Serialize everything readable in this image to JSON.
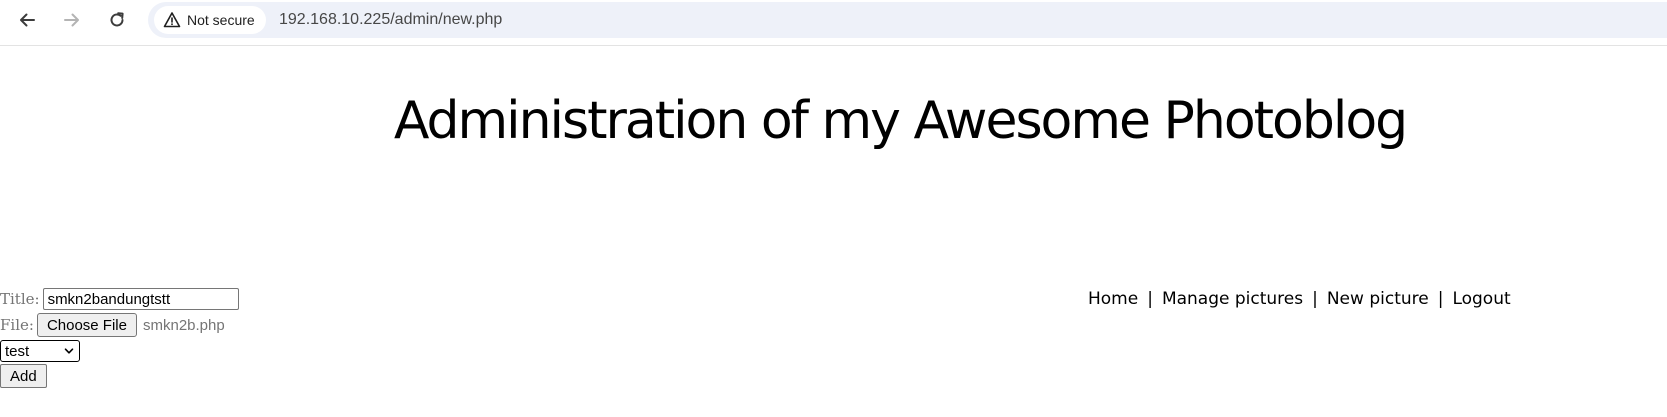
{
  "browser": {
    "security_label": "Not secure",
    "url": "192.168.10.225/admin/new.php"
  },
  "page": {
    "title": "Administration of my Awesome Photoblog",
    "menu": {
      "home": "Home",
      "manage": "Manage pictures",
      "new": "New picture",
      "logout": "Logout",
      "separator": "|"
    },
    "form": {
      "title_label": "Title:",
      "title_value": "smkn2bandungtstt",
      "file_label": "File:",
      "choose_file_label": "Choose File",
      "file_name": "smkn2b.php",
      "select_value": "test",
      "add_label": "Add"
    }
  }
}
